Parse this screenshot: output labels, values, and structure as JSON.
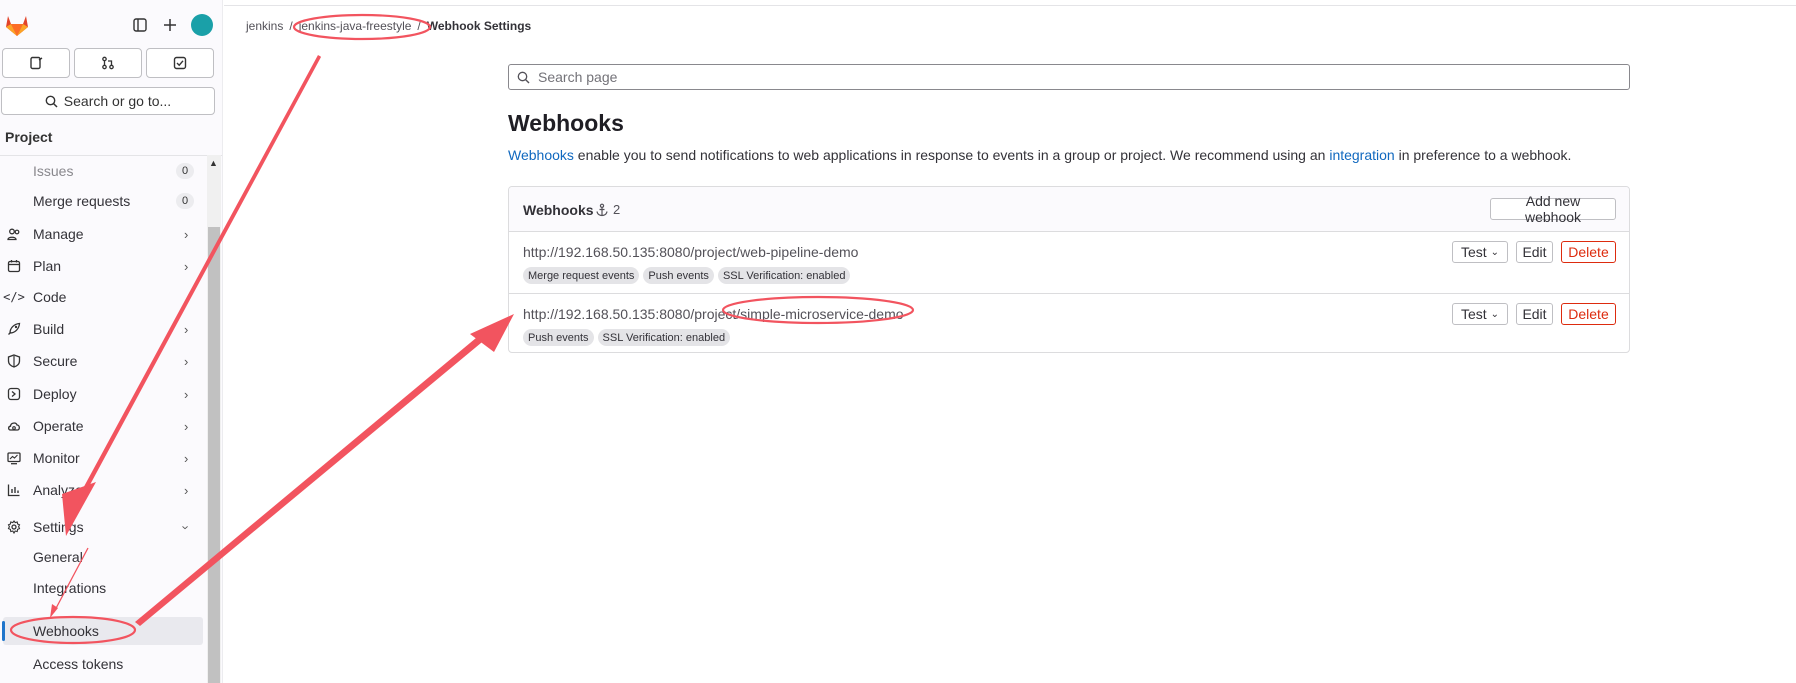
{
  "sidebar": {
    "search_label": "Search or go to...",
    "section_title": "Project",
    "items": [
      {
        "label": "Issues",
        "badge": "0",
        "icon": "issues-icon",
        "muted": true
      },
      {
        "label": "Merge requests",
        "badge": "0",
        "icon": "none"
      },
      {
        "label": "Manage",
        "icon": "users-icon"
      },
      {
        "label": "Plan",
        "icon": "calendar-icon"
      },
      {
        "label": "Code",
        "icon": "code-icon"
      },
      {
        "label": "Build",
        "icon": "rocket-icon"
      },
      {
        "label": "Secure",
        "icon": "shield-icon"
      },
      {
        "label": "Deploy",
        "icon": "deploy-icon"
      },
      {
        "label": "Operate",
        "icon": "cloud-icon"
      },
      {
        "label": "Monitor",
        "icon": "monitor-icon"
      },
      {
        "label": "Analyze",
        "icon": "chart-icon"
      },
      {
        "label": "Settings",
        "icon": "gear-icon"
      },
      {
        "label": "General"
      },
      {
        "label": "Integrations"
      },
      {
        "label": "Webhooks",
        "active": true
      },
      {
        "label": "Access tokens"
      }
    ]
  },
  "breadcrumb": {
    "items": [
      "jenkins",
      "jenkins-java-freestyle",
      "Webhook Settings"
    ]
  },
  "search": {
    "placeholder": "Search page"
  },
  "page": {
    "title": "Webhooks",
    "desc_link1": "Webhooks",
    "desc_mid": " enable you to send notifications to web applications in response to events in a group or project. We recommend using an ",
    "desc_link2": "integration",
    "desc_end": " in preference to a webhook."
  },
  "webhooks_card": {
    "title": "Webhooks",
    "count": "2",
    "add_button": "Add new webhook",
    "rows": [
      {
        "url": "http://192.168.50.135:8080/project/web-pipeline-demo",
        "tags": [
          "Merge request events",
          "Push events",
          "SSL Verification: enabled"
        ],
        "test": "Test",
        "edit": "Edit",
        "delete": "Delete"
      },
      {
        "url": "http://192.168.50.135:8080/project/simple-microservice-demo",
        "tags": [
          "Push events",
          "SSL Verification: enabled"
        ],
        "test": "Test",
        "edit": "Edit",
        "delete": "Delete"
      }
    ]
  },
  "colors": {
    "accent": "#1f75cb",
    "link": "#1068bf",
    "danger": "#dd2b0e",
    "annotation": "#f2545f"
  }
}
